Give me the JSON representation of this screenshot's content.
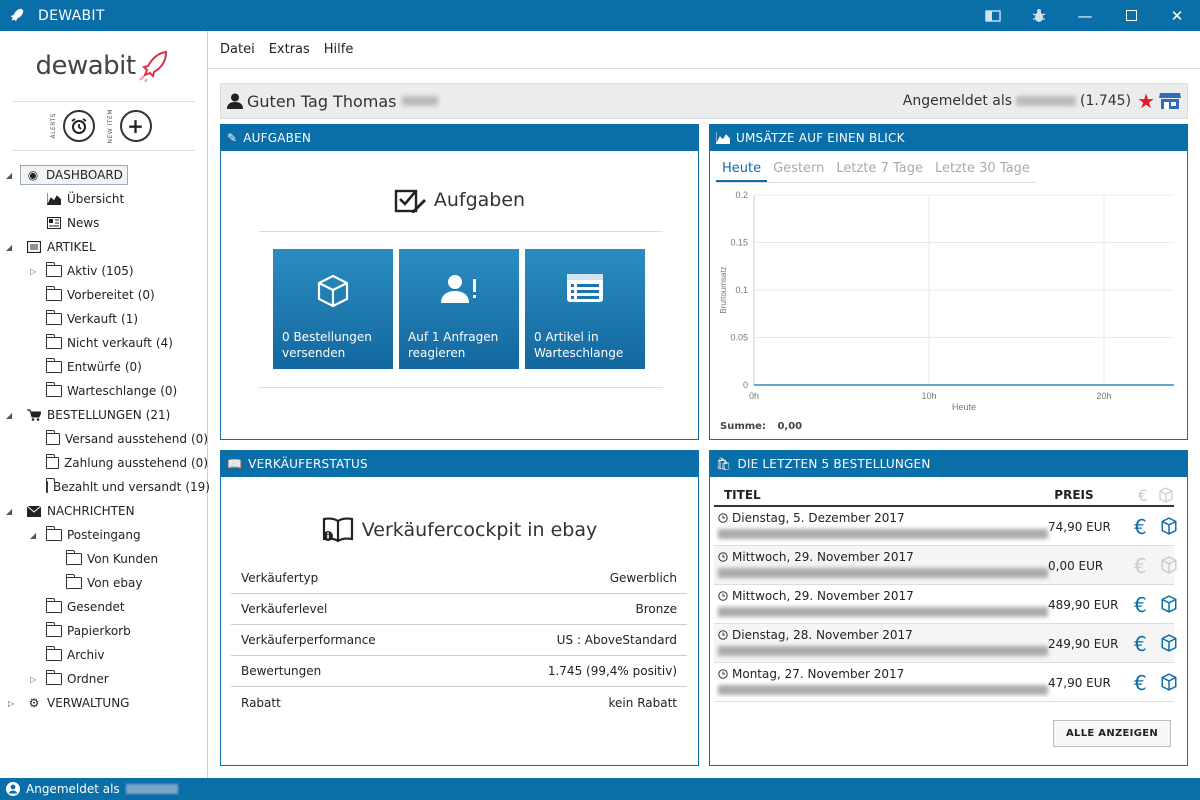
{
  "app": {
    "title": "DEWABIT",
    "logo": "dewabit"
  },
  "window": {
    "icon": "rocket-icon"
  },
  "menu": [
    "Datei",
    "Extras",
    "Hilfe"
  ],
  "quick": {
    "alerts_label": "ALERTS",
    "new_item_label": "NEW ITEM"
  },
  "tree": {
    "dashboard": "DASHBOARD",
    "uebersicht": "Übersicht",
    "news": "News",
    "artikel": "ARTIKEL",
    "aktiv": "Aktiv",
    "aktiv_cnt": "(105)",
    "vorbereitet": "Vorbereitet",
    "vorbereitet_cnt": "(0)",
    "verkauft": "Verkauft",
    "verkauft_cnt": "(1)",
    "nicht_verkauft": "Nicht verkauft",
    "nicht_verkauft_cnt": "(4)",
    "entwuerfe": "Entwürfe",
    "entwuerfe_cnt": "(0)",
    "warteschlange": "Warteschlange",
    "warteschlange_cnt": "(0)",
    "bestellungen": "BESTELLUNGEN",
    "bestellungen_cnt": "(21)",
    "versand": "Versand ausstehend",
    "versand_cnt": "(0)",
    "zahlung": "Zahlung ausstehend",
    "zahlung_cnt": "(0)",
    "bezahlt": "Bezahlt und versandt",
    "bezahlt_cnt": "(19)",
    "nachrichten": "NACHRICHTEN",
    "posteingang": "Posteingang",
    "von_kunden": "Von Kunden",
    "von_ebay": "Von ebay",
    "gesendet": "Gesendet",
    "papierkorb": "Papierkorb",
    "archiv": "Archiv",
    "ordner": "Ordner",
    "verwaltung": "VERWALTUNG"
  },
  "greeting": {
    "text": "Guten Tag Thomas",
    "login_prefix": "Angemeldet als",
    "rating": "(1.745)"
  },
  "aufgaben": {
    "header": "AUFGABEN",
    "title": "Aufgaben",
    "tiles": [
      "0 Bestellungen versenden",
      "Auf 1 Anfragen reagieren",
      "0 Artikel in Warteschlange"
    ]
  },
  "umsaetze": {
    "header": "UMSÄTZE AUF EINEN BLICK",
    "tabs": [
      "Heute",
      "Gestern",
      "Letzte 7 Tage",
      "Letzte 30 Tage"
    ],
    "summe_label": "Summe:",
    "summe_value": "0,00"
  },
  "chart_data": {
    "type": "line",
    "xlabel": "Heute",
    "ylabel": "Bruttoumsatz",
    "ylim": [
      0,
      0.2
    ],
    "yticks": [
      "0",
      "0.05",
      "0.1",
      "0.15",
      "0.2"
    ],
    "xticks": [
      "0h",
      "10h",
      "20h"
    ],
    "series": [
      {
        "values": [
          0,
          0
        ]
      }
    ]
  },
  "status": {
    "header": "VERKÄUFERSTATUS",
    "title": "Verkäufercockpit in ebay",
    "rows": [
      {
        "k": "Verkäufertyp",
        "v": "Gewerblich"
      },
      {
        "k": "Verkäuferlevel",
        "v": "Bronze"
      },
      {
        "k": "Verkäuferperformance",
        "v": "US : AboveStandard"
      },
      {
        "k": "Bewertungen",
        "v": "1.745 (99,4% positiv)"
      },
      {
        "k": "Rabatt",
        "v": "kein Rabatt"
      }
    ]
  },
  "orders": {
    "header": "DIE LETZTEN 5 BESTELLUNGEN",
    "col_title": "TITEL",
    "col_price": "PREIS",
    "button": "ALLE ANZEIGEN",
    "rows": [
      {
        "date": "Dienstag, 5. Dezember 2017",
        "price": "74,90 EUR"
      },
      {
        "date": "Mittwoch, 29. November 2017",
        "price": "0,00 EUR"
      },
      {
        "date": "Mittwoch, 29. November 2017",
        "price": "489,90 EUR"
      },
      {
        "date": "Dienstag, 28. November 2017",
        "price": "249,90 EUR"
      },
      {
        "date": "Montag, 27. November 2017",
        "price": "47,90 EUR"
      }
    ]
  },
  "statusbar": {
    "text": "Angemeldet als"
  },
  "colors": {
    "accent": "#0a6ea8",
    "star": "#e31b23"
  }
}
